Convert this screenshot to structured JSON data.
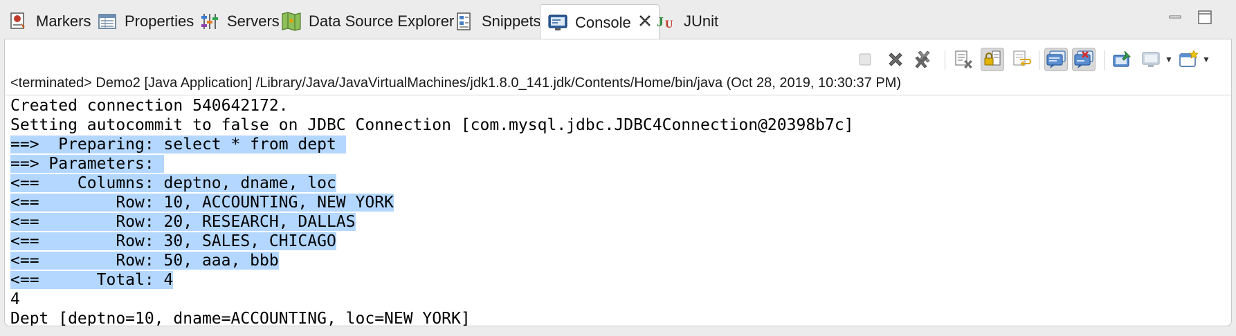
{
  "tabs": [
    {
      "label": "Markers",
      "icon": "markers-icon"
    },
    {
      "label": "Properties",
      "icon": "properties-icon"
    },
    {
      "label": "Servers",
      "icon": "servers-icon"
    },
    {
      "label": "Data Source Explorer",
      "icon": "data-source-explorer-icon"
    },
    {
      "label": "Snippets",
      "icon": "snippets-icon"
    },
    {
      "label": "Console",
      "icon": "console-icon",
      "active": true
    },
    {
      "label": "JUnit",
      "icon": "junit-icon"
    }
  ],
  "window_controls": {
    "minimize": "minimize-icon",
    "maximize": "maximize-icon"
  },
  "toolbar": {
    "buttons": [
      "terminate-icon",
      "remove-launch-icon",
      "remove-all-terminated-icon",
      "clear-console-icon",
      "scroll-lock-icon",
      "word-wrap-icon",
      "show-on-stdout-icon",
      "show-on-stderr-icon",
      "pin-console-icon",
      "display-console-icon",
      "open-console-icon"
    ]
  },
  "console": {
    "status": "<terminated> Demo2 [Java Application] /Library/Java/JavaVirtualMachines/jdk1.8.0_141.jdk/Contents/Home/bin/java (Oct 28, 2019, 10:30:37 PM)",
    "lines": [
      {
        "text": "Created connection 540642172.",
        "selected": false
      },
      {
        "text": "Setting autocommit to false on JDBC Connection [com.mysql.jdbc.JDBC4Connection@20398b7c]",
        "selected": false
      },
      {
        "text": "==>  Preparing: select * from dept ",
        "selected": true
      },
      {
        "text": "==> Parameters: ",
        "selected": true
      },
      {
        "text": "<==    Columns: deptno, dname, loc",
        "selected": true
      },
      {
        "text": "<==        Row: 10, ACCOUNTING, NEW YORK",
        "selected": true
      },
      {
        "text": "<==        Row: 20, RESEARCH, DALLAS",
        "selected": true
      },
      {
        "text": "<==        Row: 30, SALES, CHICAGO",
        "selected": true
      },
      {
        "text": "<==        Row: 50, aaa, bbb",
        "selected": true
      },
      {
        "text": "<==      Total: 4",
        "selected": true
      },
      {
        "text": "4",
        "selected": false
      },
      {
        "text": "Dept [deptno=10, dname=ACCOUNTING, loc=NEW YORK]",
        "selected": false
      }
    ]
  },
  "colors": {
    "selection": "#b3d7ff",
    "background": "#ececec",
    "panel": "#ffffff"
  }
}
